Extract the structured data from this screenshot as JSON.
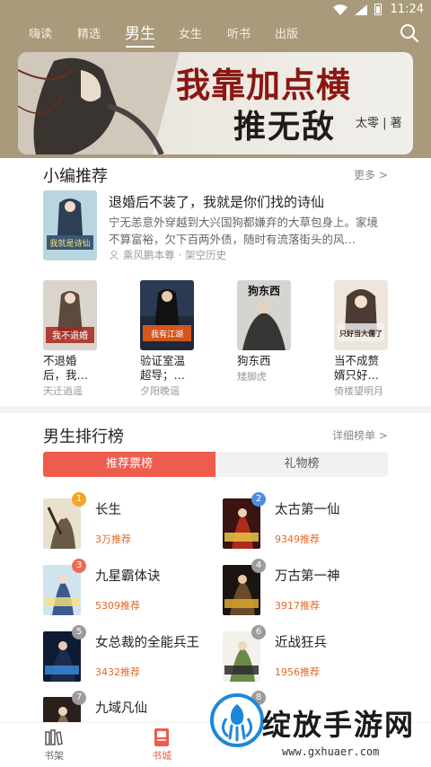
{
  "status_bar": {
    "time": "11:24"
  },
  "nav": {
    "tabs": [
      {
        "label": "嗨读"
      },
      {
        "label": "精选"
      },
      {
        "label": "男生"
      },
      {
        "label": "女生"
      },
      {
        "label": "听书"
      },
      {
        "label": "出版"
      }
    ],
    "active_tab": "男生"
  },
  "banner": {
    "title_line1": "我靠加点横",
    "title_line2": "推无敌",
    "author": "太零 | 著"
  },
  "picks": {
    "title": "小编推荐",
    "more": "更多 >",
    "feature": {
      "title": "退婚后不装了，我就是你们找的诗仙",
      "desc": "宁无恙意外穿越到大兴国狗都嫌弃的大草包身上。家境不算富裕，欠下百两外债，随时有流落街头的风…",
      "author": "乘风鹏本尊",
      "category": "架空历史",
      "cover_text": "我就是诗仙"
    },
    "books": [
      {
        "name_line1": "不退婚",
        "name_line2": "后，我…",
        "author": "天迁逍遥",
        "cover_text": "我不退婚"
      },
      {
        "name_line1": "验证室温",
        "name_line2": "超导；…",
        "author": "夕阳晚谣",
        "cover_text": "我有江湖"
      },
      {
        "name_line1": "狗东西",
        "name_line2": "",
        "author": "矮脚虎",
        "cover_text": "狗东西"
      },
      {
        "name_line1": "当不成赘",
        "name_line2": "婿只好…",
        "author": "倚楼望明月",
        "cover_text": "只好当大儒了"
      }
    ]
  },
  "ranking": {
    "title": "男生排行榜",
    "more": "详细榜单 >",
    "tabs": [
      {
        "label": "推荐票榜"
      },
      {
        "label": "礼物榜"
      }
    ],
    "items": [
      {
        "rank": "1",
        "title": "长生",
        "votes": "3万推荐",
        "badge_color": "#f5a623"
      },
      {
        "rank": "2",
        "title": "太古第一仙",
        "votes": "9349推荐",
        "badge_color": "#4a90e2"
      },
      {
        "rank": "3",
        "title": "九星霸体诀",
        "votes": "5309推荐",
        "badge_color": "#ee6b55"
      },
      {
        "rank": "4",
        "title": "万古第一神",
        "votes": "3917推荐",
        "badge_color": "#9b9b9b"
      },
      {
        "rank": "5",
        "title": "女总裁的全能兵王",
        "votes": "3432推荐",
        "badge_color": "#9b9b9b"
      },
      {
        "rank": "6",
        "title": "近战狂兵",
        "votes": "1956推荐",
        "badge_color": "#9b9b9b"
      },
      {
        "rank": "7",
        "title": "九域凡仙",
        "votes": "",
        "badge_color": "#9b9b9b"
      },
      {
        "rank": "8",
        "title": "",
        "votes": "",
        "badge_color": "#9b9b9b"
      }
    ]
  },
  "bottom_nav": {
    "items": [
      {
        "label": "书架"
      },
      {
        "label": "书城"
      }
    ],
    "active": "书城",
    "active_color": "#ee5c4d"
  },
  "watermark": {
    "text": "绽放手游网",
    "url": "www.gxhuaer.com"
  },
  "colors": {
    "header_bg": "#a89a7a",
    "accent": "#ee5c4d",
    "votes": "#e0692b"
  }
}
